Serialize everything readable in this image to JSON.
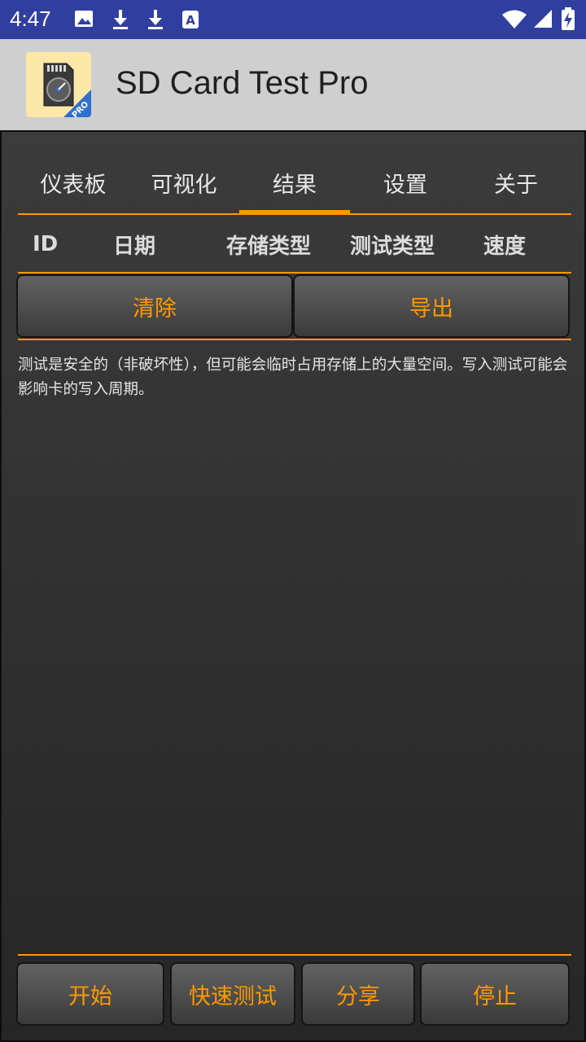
{
  "status_bar": {
    "time": "4:47",
    "icons": [
      "image-icon",
      "download-icon",
      "download-icon",
      "a-square-icon",
      "wifi-icon",
      "signal-icon",
      "battery-charging-icon"
    ]
  },
  "app": {
    "title": "SD Card Test Pro",
    "logo_badge": "PRO"
  },
  "tabs": [
    {
      "label": "仪表板"
    },
    {
      "label": "可视化"
    },
    {
      "label": "结果"
    },
    {
      "label": "设置"
    },
    {
      "label": "关于"
    }
  ],
  "active_tab": "结果",
  "table_headers": [
    "ID",
    "日期",
    "存储类型",
    "测试类型",
    "速度"
  ],
  "actions": {
    "clear": "清除",
    "export": "导出"
  },
  "notice_text": "测试是安全的（非破坏性），但可能会临时占用存储上的大量空间。写入测试可能会影响卡的写入周期。",
  "bottom_buttons": {
    "start": "开始",
    "quick_test": "快速测试",
    "share": "分享",
    "stop": "停止"
  },
  "colors": {
    "status_bar": "#303f9f",
    "app_bar": "#cfcfcf",
    "accent": "#ff9800",
    "background": "#2e2e2e"
  }
}
